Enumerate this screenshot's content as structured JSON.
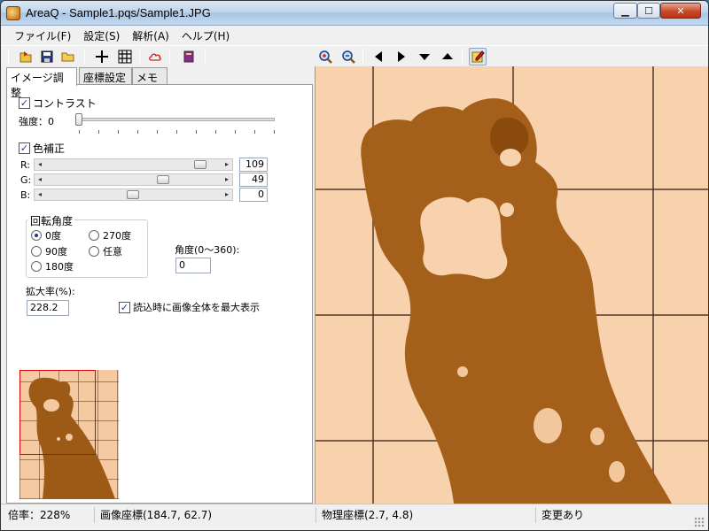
{
  "window": {
    "title": "AreaQ - Sample1.pqs/Sample1.JPG"
  },
  "window_controls": {
    "minimize": "▁",
    "maximize": "☐",
    "close": "✕"
  },
  "menu": [
    "ファイル(F)",
    "設定(S)",
    "解析(A)",
    "ヘルプ(H)"
  ],
  "toolbar": {
    "icons": [
      "open-project-icon",
      "save-icon",
      "open-folder-icon",
      "crosshair-icon",
      "grid-icon",
      "cloud-shape-icon",
      "book-icon",
      "zoom-in-icon",
      "zoom-out-icon",
      "arrow-left-icon",
      "arrow-right-icon",
      "arrow-down-icon",
      "arrow-up-icon",
      "edit-mode-icon"
    ]
  },
  "tabs": [
    "イメージ調整",
    "座標設定",
    "メモ"
  ],
  "contrast": {
    "label": "コントラスト",
    "checked": true,
    "strength_label": "強度：0"
  },
  "color_correction": {
    "label": "色補正",
    "checked": true,
    "channels": [
      {
        "label": "R:",
        "value": "109"
      },
      {
        "label": "G:",
        "value": "49"
      },
      {
        "label": "B:",
        "value": "0"
      }
    ]
  },
  "rotation": {
    "title": "回転角度",
    "options": [
      "0度",
      "270度",
      "90度",
      "任意",
      "180度"
    ],
    "selected": "0度",
    "angle_label": "角度(0〜360):",
    "angle_value": "0"
  },
  "zoom": {
    "label": "拡大率(%):",
    "value": "228.2"
  },
  "fit_on_load": {
    "label": "読込時に画像全体を最大表示",
    "checked": true
  },
  "status": {
    "zoom": "倍率：228%",
    "image_coords": "画像座標(184.7, 62.7)",
    "physical_coords": "物理座標(2.7, 4.8)",
    "modified": "変更あり"
  },
  "colors": {
    "stain": "#a4601a",
    "stain_dark": "#8a4a0e",
    "paper": "#f7d2ad",
    "grid_line": "#5a3c28",
    "selection_frame": "#e00000"
  }
}
